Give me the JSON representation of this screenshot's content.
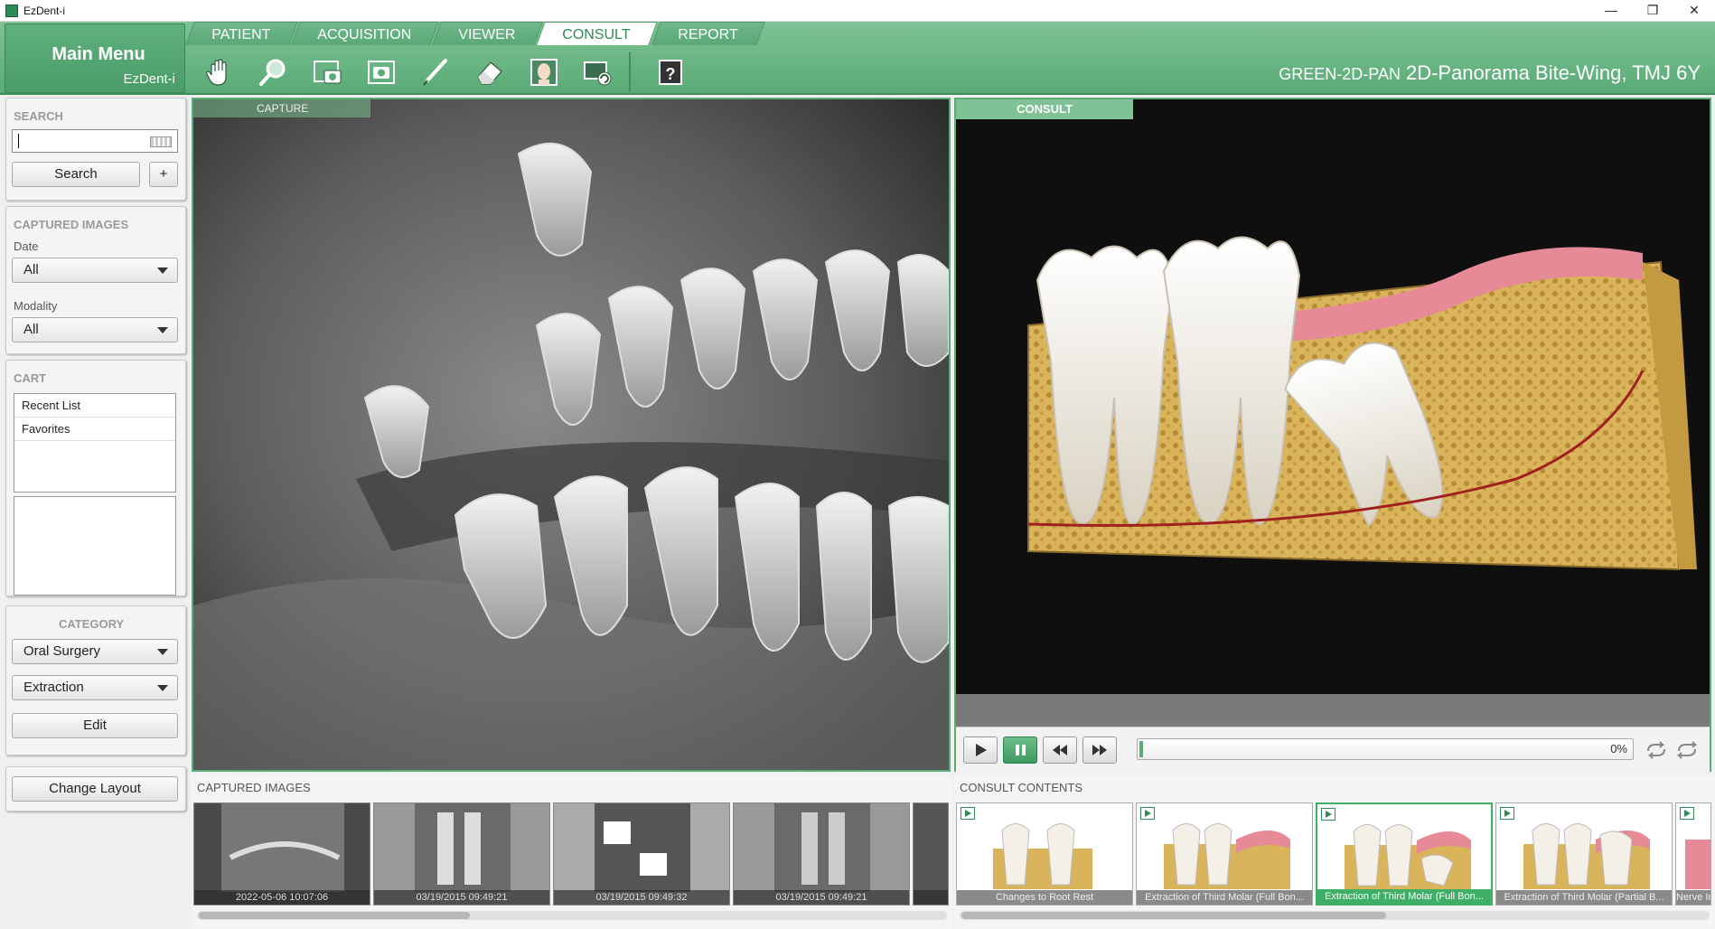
{
  "window": {
    "title": "EzDent-i",
    "controls": [
      "—",
      "❐",
      "✕"
    ]
  },
  "main_menu": {
    "title": "Main Menu",
    "subtitle": "EzDent-i"
  },
  "tabs": [
    {
      "label": "PATIENT",
      "active": false
    },
    {
      "label": "ACQUISITION",
      "active": false
    },
    {
      "label": "VIEWER",
      "active": false
    },
    {
      "label": "CONSULT",
      "active": true
    },
    {
      "label": "REPORT",
      "active": false
    }
  ],
  "toolbar": {
    "icons": [
      "hand-pan-icon",
      "magnifier-icon",
      "camera-capture-icon",
      "photo-frame-icon",
      "pen-draw-icon",
      "eraser-icon",
      "face-profile-icon",
      "image-refresh-icon",
      "help-icon"
    ],
    "help_glyph": "?"
  },
  "patient": {
    "id": "GREEN-2D-PAN",
    "description": "2D-Panorama Bite-Wing, TMJ 6Y"
  },
  "search": {
    "title": "SEARCH",
    "value": "",
    "button": "Search",
    "add": "+"
  },
  "captured_filter": {
    "title": "CAPTURED IMAGES",
    "date_label": "Date",
    "date_value": "All",
    "modality_label": "Modality",
    "modality_value": "All"
  },
  "cart": {
    "title": "CART",
    "items": [
      "Recent List",
      "Favorites"
    ]
  },
  "category": {
    "title": "CATEGORY",
    "primary": "Oral Surgery",
    "secondary": "Extraction",
    "edit": "Edit"
  },
  "layout": {
    "change": "Change Layout"
  },
  "capture_panel": {
    "label": "CAPTURE"
  },
  "consult_panel": {
    "label": "CONSULT",
    "progress_percent": 0,
    "progress_text": "0%"
  },
  "captured_images": {
    "title": "CAPTURED IMAGES",
    "items": [
      {
        "caption": "2022-05-06 10:07:06"
      },
      {
        "caption": "03/19/2015 09:49:21"
      },
      {
        "caption": "03/19/2015 09:49:32"
      },
      {
        "caption": "03/19/2015 09:49:21"
      },
      {
        "caption": ""
      }
    ]
  },
  "consult_contents": {
    "title": "CONSULT CONTENTS",
    "items": [
      {
        "caption": "Changes to Root Rest",
        "selected": false
      },
      {
        "caption": "Extraction of Third Molar (Full Bon...",
        "selected": false
      },
      {
        "caption": "Extraction of Third Molar (Full Bon...",
        "selected": true
      },
      {
        "caption": "Extraction of Third Molar (Partial B...",
        "selected": false
      },
      {
        "caption": "Nerve Inj",
        "selected": false
      }
    ]
  },
  "colors": {
    "accent": "#5aab76",
    "accent_dark": "#3f8d5b",
    "selected": "#3fae66"
  }
}
